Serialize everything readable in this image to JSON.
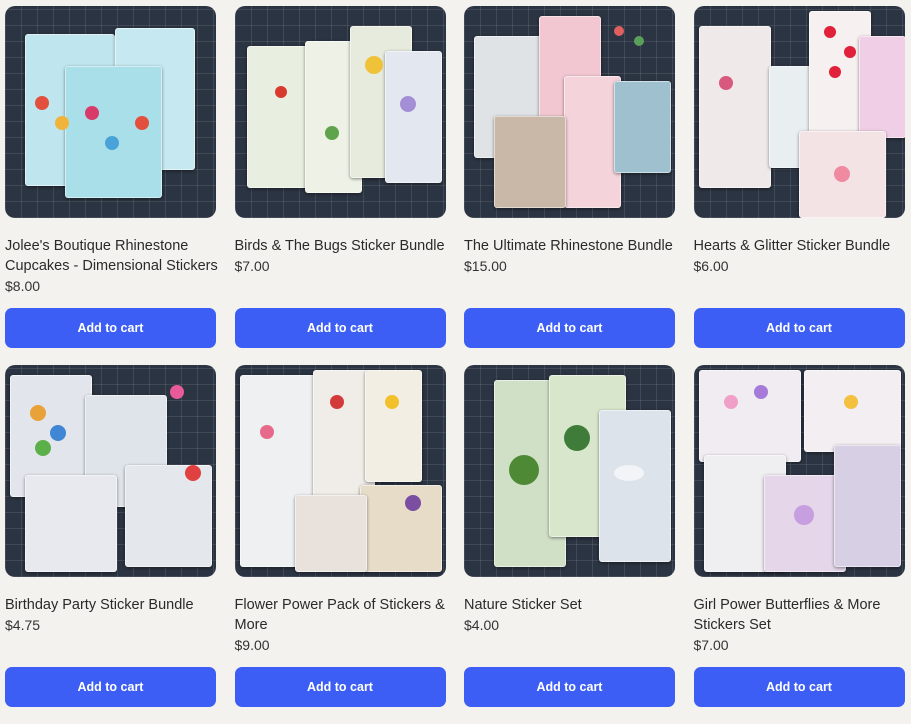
{
  "products": [
    {
      "title": "Jolee's Boutique Rhinestone Cupcakes - Dimensional Stickers",
      "price": "$8.00",
      "button": "Add to cart",
      "image": "cupcake-stickers-photo"
    },
    {
      "title": "Birds & The Bugs Sticker Bundle",
      "price": "$7.00",
      "button": "Add to cart",
      "image": "birds-bugs-stickers-photo"
    },
    {
      "title": "The Ultimate Rhinestone Bundle",
      "price": "$15.00",
      "button": "Add to cart",
      "image": "rhinestone-bundle-photo"
    },
    {
      "title": "Hearts & Glitter Sticker Bundle",
      "price": "$6.00",
      "button": "Add to cart",
      "image": "hearts-glitter-stickers-photo"
    },
    {
      "title": "Birthday Party Sticker Bundle",
      "price": "$4.75",
      "button": "Add to cart",
      "image": "birthday-party-stickers-photo"
    },
    {
      "title": "Flower Power Pack of Stickers & More",
      "price": "$9.00",
      "button": "Add to cart",
      "image": "flower-power-stickers-photo"
    },
    {
      "title": "Nature Sticker Set",
      "price": "$4.00",
      "button": "Add to cart",
      "image": "nature-stickers-photo"
    },
    {
      "title": "Girl Power Butterflies & More Stickers Set",
      "price": "$7.00",
      "button": "Add to cart",
      "image": "butterfly-stickers-photo"
    }
  ],
  "colors": {
    "button": "#3c5ef5",
    "background": "#f4f2ee",
    "mat": "#2b3442"
  }
}
